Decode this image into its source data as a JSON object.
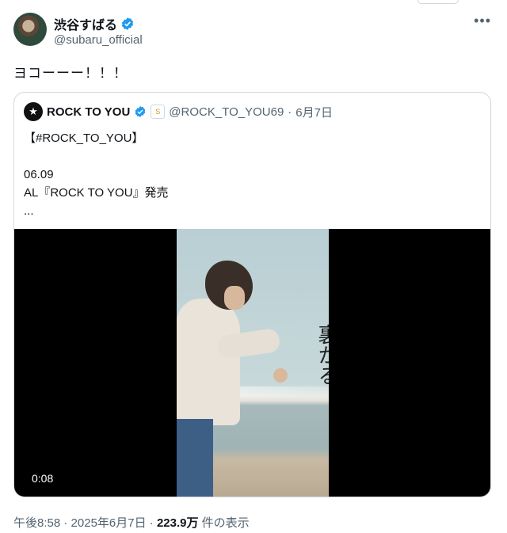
{
  "author": {
    "name": "渋谷すばる",
    "handle": "@subaru_official",
    "verified_color": "#1d9bf0"
  },
  "tweet": {
    "text": "ヨコーーー！！！"
  },
  "quoted": {
    "name": "ROCK TO YOU",
    "handle": "@ROCK_TO_YOU69",
    "separator": "·",
    "date": "6月7日",
    "body": "【#ROCK_TO_YOU】\n\n06.09\nAL『ROCK TO YOU』発売\n...",
    "video": {
      "timecode": "0:08",
      "overlay_text": "裏かる"
    }
  },
  "meta": {
    "time": "午後8:58",
    "sep1": " · ",
    "date": "2025年6月7日",
    "sep2": " · ",
    "views": "223.9万",
    "views_label": " 件の表示"
  },
  "icons": {
    "more": "more-horizontal-icon",
    "verified": "verified-badge-icon",
    "affiliation": "affiliation-badge-icon"
  }
}
